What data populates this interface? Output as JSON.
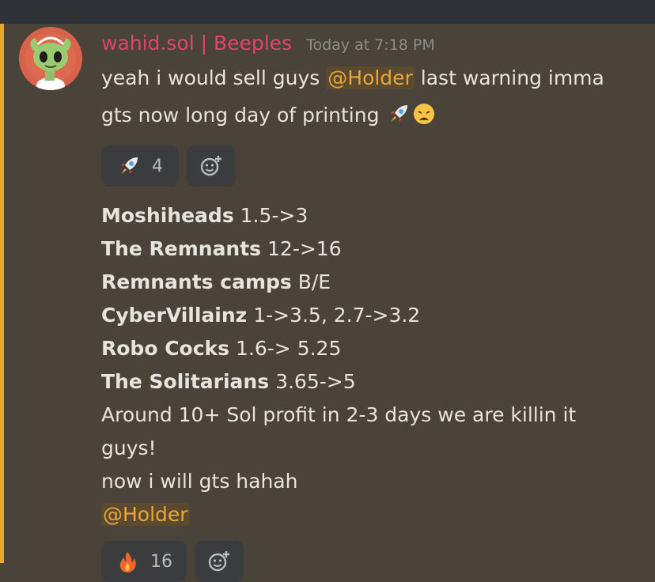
{
  "message": {
    "username": "wahid.sol | Beeples",
    "timestamp": "Today at 7:18 PM",
    "text1_before": "yeah i would sell guys ",
    "mention1": "@Holder",
    "text1_after": " last warning imma",
    "text2": "gts now long day of printing ",
    "emojis": [
      "rocket-emoji",
      "weary-face-emoji"
    ]
  },
  "reactions_top": [
    {
      "icon": "rocket-icon",
      "count": "4"
    },
    {
      "icon": "add-reaction-icon"
    }
  ],
  "trades": [
    {
      "name": "Moshiheads",
      "value": "1.5->3"
    },
    {
      "name": "The Remnants",
      "value": "12->16"
    },
    {
      "name": "Remnants camps",
      "value": "B/E"
    },
    {
      "name": "CyberVillainz",
      "value": "1->3.5, 2.7->3.2"
    },
    {
      "name": "Robo Cocks",
      "value": "1.6-> 5.25"
    },
    {
      "name": "The Solitarians",
      "value": "3.65->5"
    }
  ],
  "closing": {
    "line1": "Around 10+ Sol profit in 2-3 days we are killin it",
    "line2": "guys!",
    "line3": "now i will gts hahah",
    "mention": "@Holder"
  },
  "reactions_bottom": [
    {
      "icon": "fire-icon",
      "count": "16"
    },
    {
      "icon": "add-reaction-icon"
    }
  ],
  "colors": {
    "background": "#49433a",
    "username": "#e0466c",
    "mention": "#e8a63a",
    "accent_bar": "#e6a82b"
  }
}
